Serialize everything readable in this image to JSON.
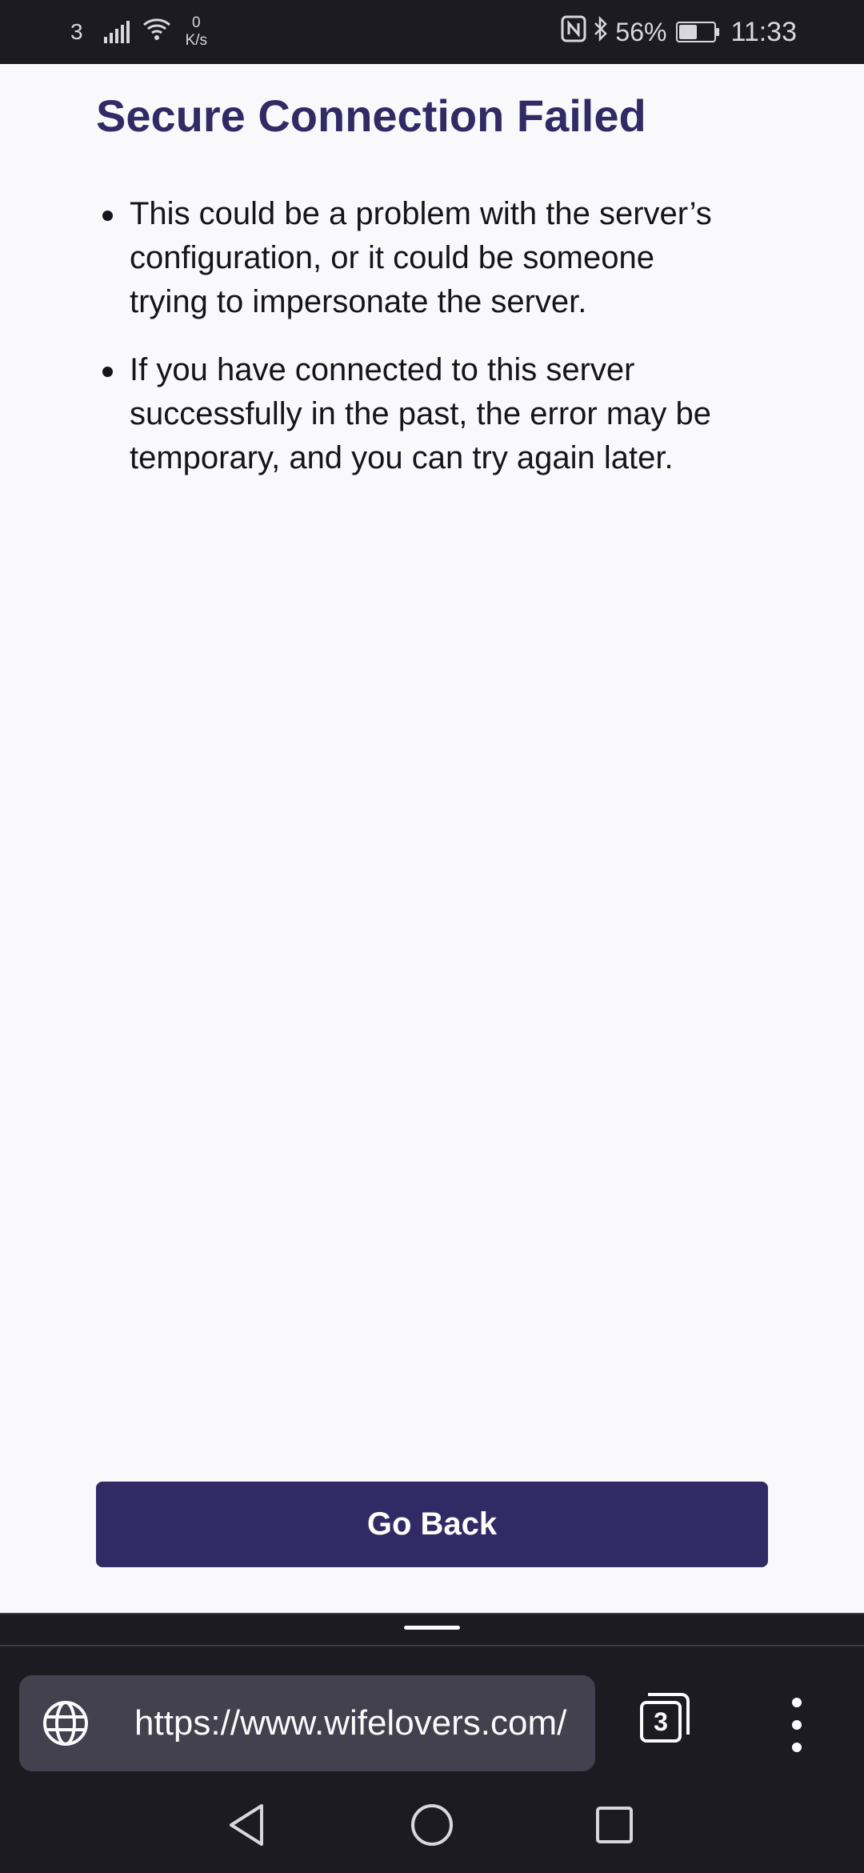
{
  "status_bar": {
    "carrier": "3",
    "speed_value": "0",
    "speed_unit": "K/s",
    "battery_percent": "56%",
    "battery_level": 0.56,
    "time": "11:33"
  },
  "page": {
    "title": "Secure Connection Failed",
    "bullets": [
      "This could be a problem with the server’s configuration, or it could be someone trying to impersonate the server.",
      "If you have connected to this server successfully in the past, the error may be temporary, and you can try again later."
    ],
    "go_back_label": "Go Back"
  },
  "toolbar": {
    "url": "https://www.wifelovers.com/",
    "tab_count": "3",
    "site_icon": "globe-icon",
    "menu_icon": "more-vertical-icon"
  },
  "nav_bar": {
    "back_icon": "back-triangle-icon",
    "home_icon": "home-circle-icon",
    "recents_icon": "recents-square-icon"
  },
  "colors": {
    "title": "#312a65",
    "button": "#312a65",
    "background": "#f9f9fb",
    "chrome": "#1c1b22",
    "url_bar": "#42414d"
  }
}
